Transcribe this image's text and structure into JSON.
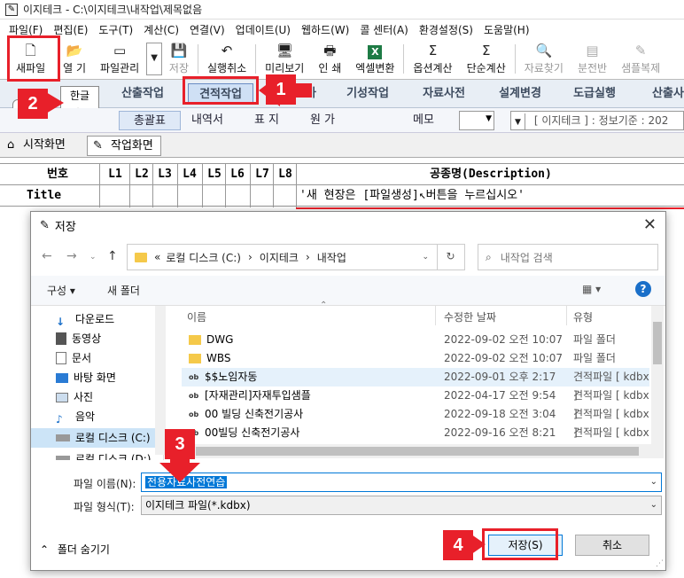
{
  "app": {
    "title": "이지테크 - C:\\이지테크\\내작업\\제목없음",
    "menu": [
      "파일(F)",
      "편집(E)",
      "도구(T)",
      "계산(C)",
      "연결(V)",
      "업데이트(U)",
      "웹하드(W)",
      "콜 센터(A)",
      "환경설정(S)",
      "도움말(H)"
    ]
  },
  "toolbar": {
    "new": "새파일",
    "open": "열 기",
    "manage": "파일관리",
    "save": "저장",
    "undo": "실행취소",
    "preview": "미리보기",
    "print": "인 쇄",
    "excel": "엑셀변환",
    "optcalc": "옵션계산",
    "simplecalc": "단순계산",
    "find": "자료찾기",
    "split": "분전반",
    "sample": "샘플복제"
  },
  "mode": {
    "hangul": "한글",
    "english": "영문"
  },
  "tabs": [
    "산출작업",
    "견적작업",
    "가",
    "기성작업",
    "자료사전",
    "설계변경",
    "도급실행",
    "산출사"
  ],
  "subtabs": {
    "summary": "총괄표",
    "detail": "내역서",
    "table": "표 지",
    "unit": "원 가",
    "memo": "메모",
    "info": "[ 이지테크 ] : 정보기준 : 202"
  },
  "doctabs": {
    "start": "시작화면",
    "work": "작업화면"
  },
  "grid": {
    "headers": {
      "no": "번호",
      "l1": "L1",
      "l2": "L2",
      "l3": "L3",
      "l4": "L4",
      "l5": "L5",
      "l6": "L6",
      "l7": "L7",
      "l8": "L8",
      "desc": "공종명(Description)"
    },
    "row_title": "Title",
    "row_desc": "'새 현장은 [파일생성]↖버튼을 누르십시오'"
  },
  "badges": {
    "b1": "1",
    "b2": "2",
    "b3": "3",
    "b4": "4"
  },
  "dialog": {
    "title": "저장",
    "path": {
      "chev": "«",
      "drive": "로컬 디스크 (C:)",
      "sep1": "›",
      "folder1": "이지테크",
      "sep2": "›",
      "folder2": "내작업"
    },
    "search_placeholder": "내작업 검색",
    "organize": "구성 ▾",
    "newfolder": "새 폴더",
    "sidebar": [
      "다운로드",
      "동영상",
      "문서",
      "바탕 화면",
      "사진",
      "음악",
      "로컬 디스크 (C:)",
      "로컬 디스크 (D:)"
    ],
    "columns": {
      "name": "이름",
      "date": "수정한 날짜",
      "type": "유형"
    },
    "files": [
      {
        "name": "DWG",
        "date": "2022-09-02 오전 10:07",
        "type": "파일 폴더",
        "kind": "folder"
      },
      {
        "name": "WBS",
        "date": "2022-09-02 오전 10:07",
        "type": "파일 폴더",
        "kind": "folder"
      },
      {
        "name": "$$노임자동",
        "date": "2022-09-01 오후 2:17",
        "type": "견적파일 [ kdbx ]",
        "kind": "file"
      },
      {
        "name": "[자재관리]자재투입샘플",
        "date": "2022-04-17 오전 9:54",
        "type": "견적파일 [ kdbx ]",
        "kind": "file"
      },
      {
        "name": "00 빌딩 신축전기공사",
        "date": "2022-09-18 오전 3:04",
        "type": "견적파일 [ kdbx ]",
        "kind": "file"
      },
      {
        "name": "00빌딩 신축전기공사",
        "date": "2022-09-16 오전 8:21",
        "type": "견적파일 [ kdbx ]",
        "kind": "file"
      }
    ],
    "filename_label": "파일 이름(N):",
    "filename_value": "전용자료사전연습",
    "filetype_label": "파일 형식(T):",
    "filetype_value": "이지테크 파일(*.kdbx)",
    "hide_folders": "폴더 숨기기",
    "save": "저장(S)",
    "cancel": "취소"
  }
}
